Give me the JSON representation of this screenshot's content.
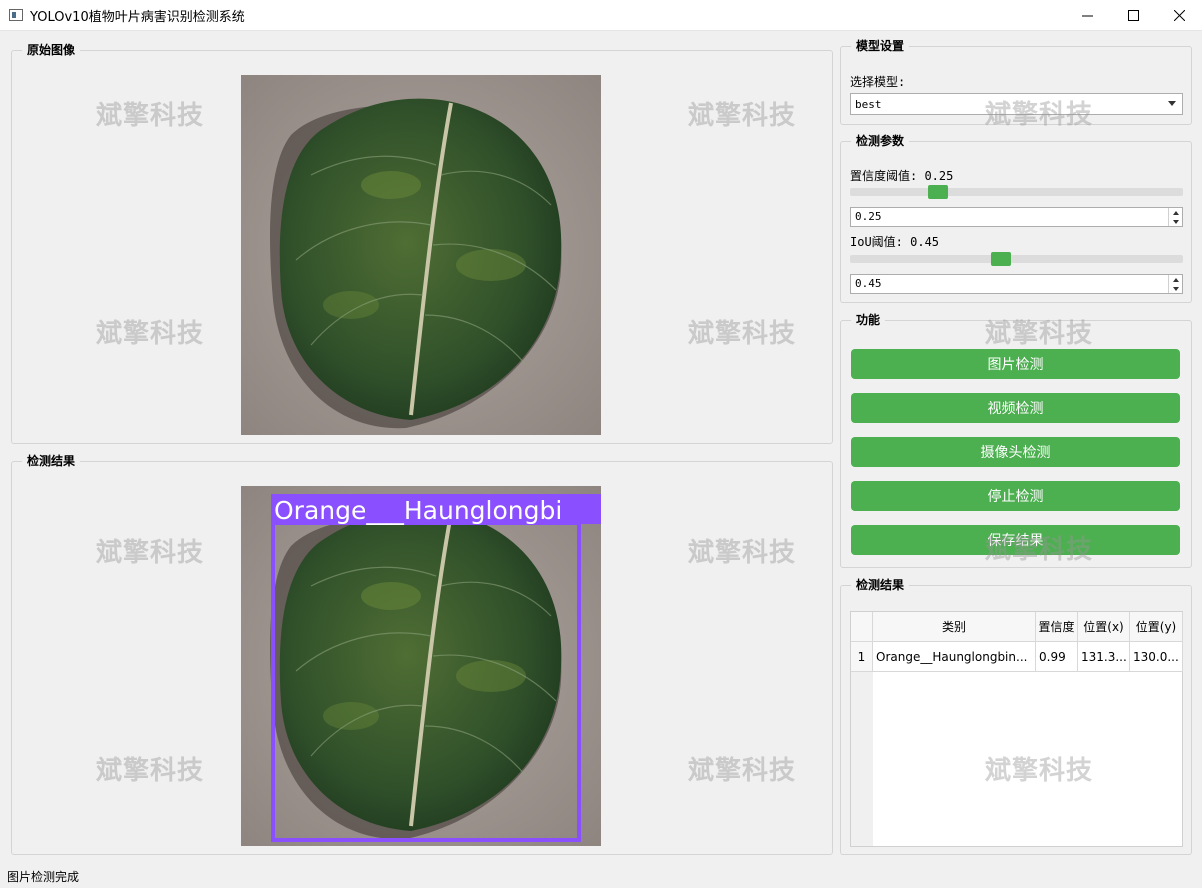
{
  "window": {
    "title": "YOLOv10植物叶片病害识别检测系统"
  },
  "watermark": "斌擎科技",
  "panels": {
    "original": {
      "title": "原始图像"
    },
    "result": {
      "title": "检测结果"
    }
  },
  "detection_overlay": {
    "label": "Orange___Haunglongbi",
    "color": "#8a4fff"
  },
  "model_settings": {
    "title": "模型设置",
    "select_label": "选择模型:",
    "selected": "best"
  },
  "detection_params": {
    "title": "检测参数",
    "conf_label": "置信度阈值: 0.25",
    "conf_value": "0.25",
    "conf_fraction": 0.25,
    "iou_label": "IoU阈值: 0.45",
    "iou_value": "0.45",
    "iou_fraction": 0.45
  },
  "functions": {
    "title": "功能",
    "buttons": [
      "图片检测",
      "视频检测",
      "摄像头检测",
      "停止检测",
      "保存结果"
    ],
    "color": "#4caf50"
  },
  "results": {
    "title": "检测结果",
    "columns": [
      "类别",
      "置信度",
      "位置(x)",
      "位置(y)"
    ],
    "rows": [
      {
        "index": "1",
        "class": "Orange__Haunglongbin...",
        "conf": "0.99",
        "x": "131.3...",
        "y": "130.0..."
      }
    ]
  },
  "status": "图片检测完成"
}
